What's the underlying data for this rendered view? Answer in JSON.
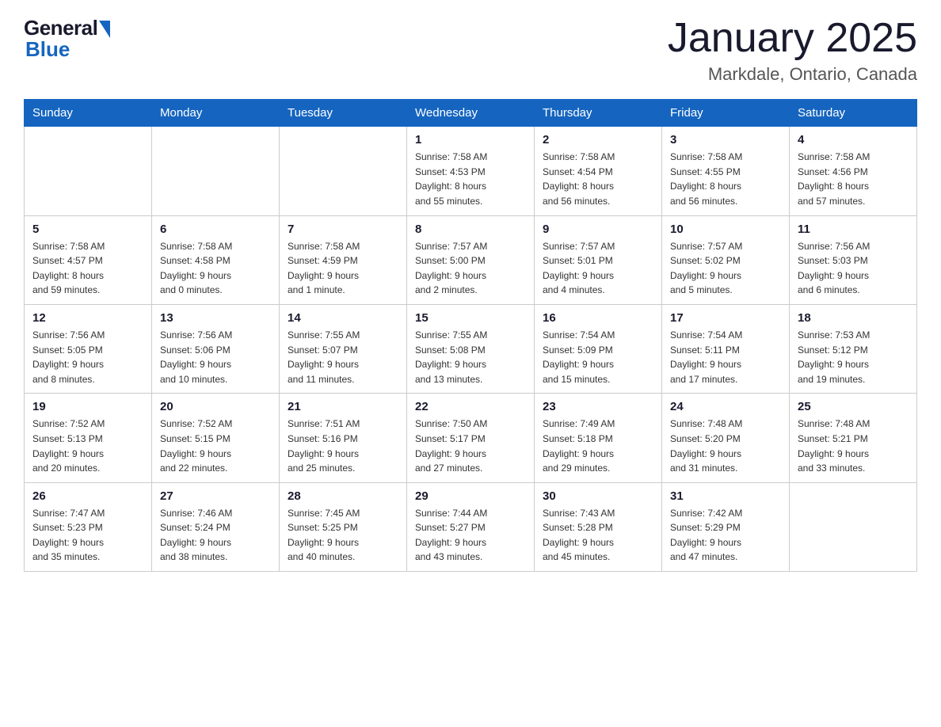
{
  "header": {
    "logo_general": "General",
    "logo_blue": "Blue",
    "month_title": "January 2025",
    "location": "Markdale, Ontario, Canada"
  },
  "weekdays": [
    "Sunday",
    "Monday",
    "Tuesday",
    "Wednesday",
    "Thursday",
    "Friday",
    "Saturday"
  ],
  "weeks": [
    [
      {
        "day": "",
        "info": ""
      },
      {
        "day": "",
        "info": ""
      },
      {
        "day": "",
        "info": ""
      },
      {
        "day": "1",
        "info": "Sunrise: 7:58 AM\nSunset: 4:53 PM\nDaylight: 8 hours\nand 55 minutes."
      },
      {
        "day": "2",
        "info": "Sunrise: 7:58 AM\nSunset: 4:54 PM\nDaylight: 8 hours\nand 56 minutes."
      },
      {
        "day": "3",
        "info": "Sunrise: 7:58 AM\nSunset: 4:55 PM\nDaylight: 8 hours\nand 56 minutes."
      },
      {
        "day": "4",
        "info": "Sunrise: 7:58 AM\nSunset: 4:56 PM\nDaylight: 8 hours\nand 57 minutes."
      }
    ],
    [
      {
        "day": "5",
        "info": "Sunrise: 7:58 AM\nSunset: 4:57 PM\nDaylight: 8 hours\nand 59 minutes."
      },
      {
        "day": "6",
        "info": "Sunrise: 7:58 AM\nSunset: 4:58 PM\nDaylight: 9 hours\nand 0 minutes."
      },
      {
        "day": "7",
        "info": "Sunrise: 7:58 AM\nSunset: 4:59 PM\nDaylight: 9 hours\nand 1 minute."
      },
      {
        "day": "8",
        "info": "Sunrise: 7:57 AM\nSunset: 5:00 PM\nDaylight: 9 hours\nand 2 minutes."
      },
      {
        "day": "9",
        "info": "Sunrise: 7:57 AM\nSunset: 5:01 PM\nDaylight: 9 hours\nand 4 minutes."
      },
      {
        "day": "10",
        "info": "Sunrise: 7:57 AM\nSunset: 5:02 PM\nDaylight: 9 hours\nand 5 minutes."
      },
      {
        "day": "11",
        "info": "Sunrise: 7:56 AM\nSunset: 5:03 PM\nDaylight: 9 hours\nand 6 minutes."
      }
    ],
    [
      {
        "day": "12",
        "info": "Sunrise: 7:56 AM\nSunset: 5:05 PM\nDaylight: 9 hours\nand 8 minutes."
      },
      {
        "day": "13",
        "info": "Sunrise: 7:56 AM\nSunset: 5:06 PM\nDaylight: 9 hours\nand 10 minutes."
      },
      {
        "day": "14",
        "info": "Sunrise: 7:55 AM\nSunset: 5:07 PM\nDaylight: 9 hours\nand 11 minutes."
      },
      {
        "day": "15",
        "info": "Sunrise: 7:55 AM\nSunset: 5:08 PM\nDaylight: 9 hours\nand 13 minutes."
      },
      {
        "day": "16",
        "info": "Sunrise: 7:54 AM\nSunset: 5:09 PM\nDaylight: 9 hours\nand 15 minutes."
      },
      {
        "day": "17",
        "info": "Sunrise: 7:54 AM\nSunset: 5:11 PM\nDaylight: 9 hours\nand 17 minutes."
      },
      {
        "day": "18",
        "info": "Sunrise: 7:53 AM\nSunset: 5:12 PM\nDaylight: 9 hours\nand 19 minutes."
      }
    ],
    [
      {
        "day": "19",
        "info": "Sunrise: 7:52 AM\nSunset: 5:13 PM\nDaylight: 9 hours\nand 20 minutes."
      },
      {
        "day": "20",
        "info": "Sunrise: 7:52 AM\nSunset: 5:15 PM\nDaylight: 9 hours\nand 22 minutes."
      },
      {
        "day": "21",
        "info": "Sunrise: 7:51 AM\nSunset: 5:16 PM\nDaylight: 9 hours\nand 25 minutes."
      },
      {
        "day": "22",
        "info": "Sunrise: 7:50 AM\nSunset: 5:17 PM\nDaylight: 9 hours\nand 27 minutes."
      },
      {
        "day": "23",
        "info": "Sunrise: 7:49 AM\nSunset: 5:18 PM\nDaylight: 9 hours\nand 29 minutes."
      },
      {
        "day": "24",
        "info": "Sunrise: 7:48 AM\nSunset: 5:20 PM\nDaylight: 9 hours\nand 31 minutes."
      },
      {
        "day": "25",
        "info": "Sunrise: 7:48 AM\nSunset: 5:21 PM\nDaylight: 9 hours\nand 33 minutes."
      }
    ],
    [
      {
        "day": "26",
        "info": "Sunrise: 7:47 AM\nSunset: 5:23 PM\nDaylight: 9 hours\nand 35 minutes."
      },
      {
        "day": "27",
        "info": "Sunrise: 7:46 AM\nSunset: 5:24 PM\nDaylight: 9 hours\nand 38 minutes."
      },
      {
        "day": "28",
        "info": "Sunrise: 7:45 AM\nSunset: 5:25 PM\nDaylight: 9 hours\nand 40 minutes."
      },
      {
        "day": "29",
        "info": "Sunrise: 7:44 AM\nSunset: 5:27 PM\nDaylight: 9 hours\nand 43 minutes."
      },
      {
        "day": "30",
        "info": "Sunrise: 7:43 AM\nSunset: 5:28 PM\nDaylight: 9 hours\nand 45 minutes."
      },
      {
        "day": "31",
        "info": "Sunrise: 7:42 AM\nSunset: 5:29 PM\nDaylight: 9 hours\nand 47 minutes."
      },
      {
        "day": "",
        "info": ""
      }
    ]
  ]
}
